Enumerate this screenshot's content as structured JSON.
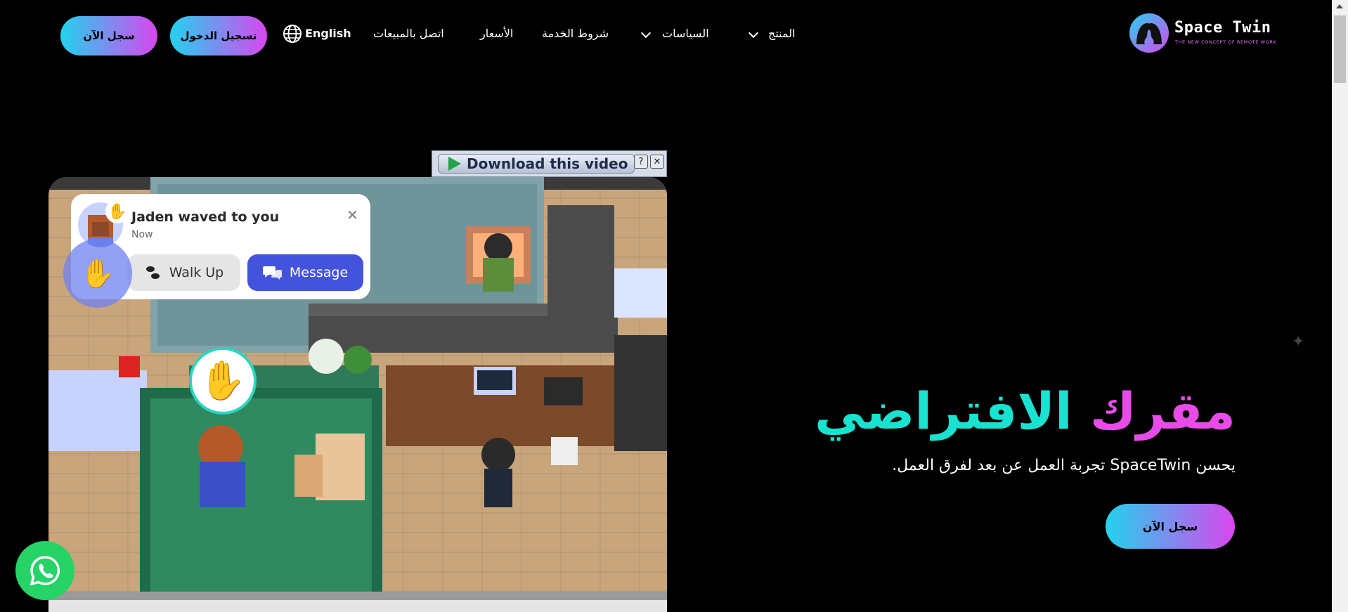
{
  "header": {
    "logo_title": "Space Twin",
    "logo_subtitle": "THE NEW CONCEPT OF REMOTE WORK",
    "nav": {
      "product": "المنتج",
      "policies": "السياسات",
      "terms": "شروط الخدمة",
      "pricing": "الأسعار",
      "contact_sales": "اتصل بالمبيعات",
      "language": "English"
    },
    "login_label": "تسجيل الدخول",
    "signup_label": "سجل الآن"
  },
  "hero": {
    "title_part1": "مقرك",
    "title_part2": "الافتراضي",
    "description": "يحسن SpaceTwin تجربة العمل عن بعد لفرق العمل.",
    "cta_label": "سجل الآن"
  },
  "video_toolbar": {
    "download_label": "Download this video",
    "help_label": "?",
    "close_label": "✕"
  },
  "notification": {
    "title": "Jaden waved to you",
    "time": "Now",
    "walk_up_label": "Walk Up",
    "message_label": "Message"
  },
  "colors": {
    "accent_cyan": "#22d3ee",
    "accent_pink": "#d946ef",
    "title_pink": "#e94be8",
    "title_cyan": "#19e3d0",
    "message_blue": "#4453db",
    "whatsapp_green": "#25d366"
  },
  "icons": {
    "language": "globe-icon",
    "dropdown": "chevron-down-icon",
    "whatsapp": "whatsapp-icon"
  }
}
